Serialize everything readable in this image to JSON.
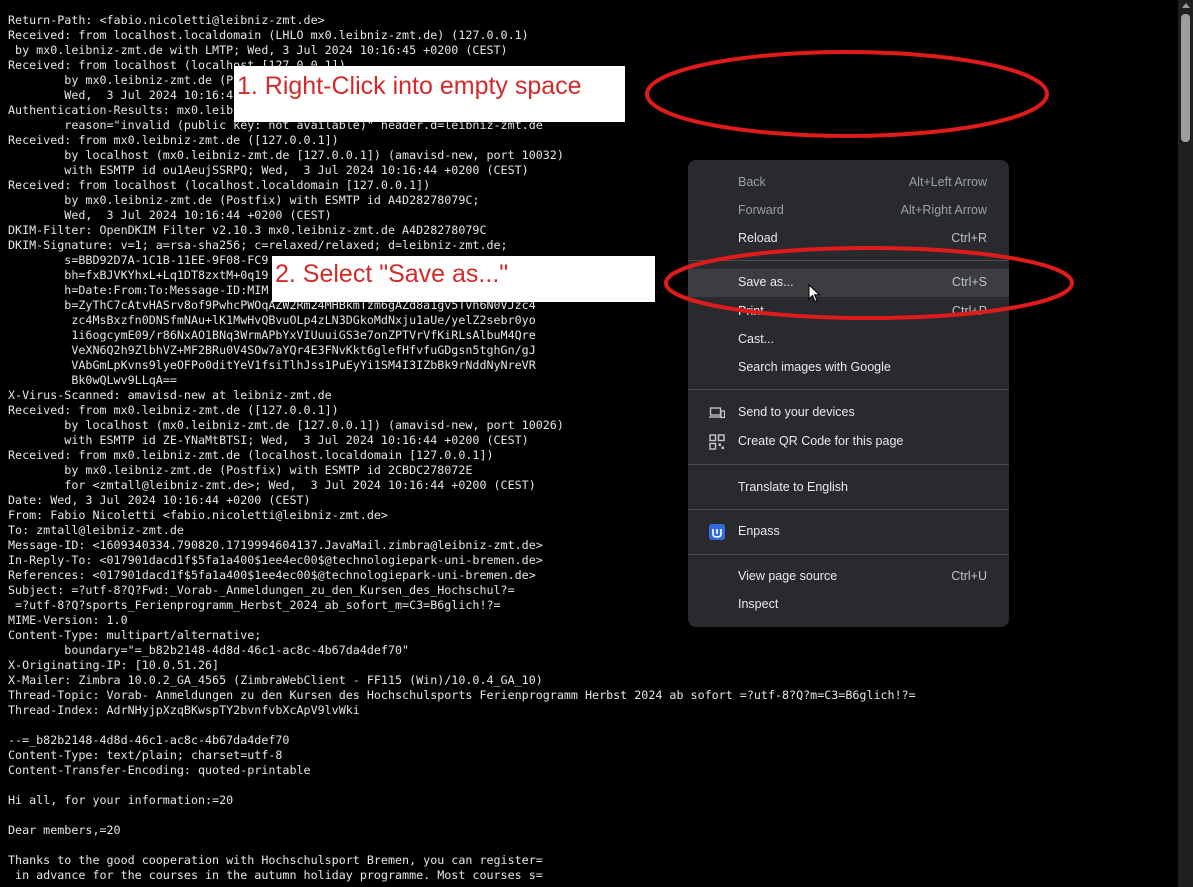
{
  "source_lines": [
    "Return-Path: <fabio.nicoletti@leibniz-zmt.de>",
    "Received: from localhost.localdomain (LHLO mx0.leibniz-zmt.de) (127.0.0.1)",
    " by mx0.leibniz-zmt.de with LMTP; Wed, 3 Jul 2024 10:16:45 +0200 (CEST)",
    "Received: from localhost (localhost [127.0.0.1])",
    "        by mx0.leibniz-zmt.de (P",
    "        Wed,  3 Jul 2024 10:16:4",
    "Authentication-Results: mx0.leibn",
    "        reason=\"invalid (public key: not available)\" header.d=leibniz-zmt.de",
    "Received: from mx0.leibniz-zmt.de ([127.0.0.1])",
    "        by localhost (mx0.leibniz-zmt.de [127.0.0.1]) (amavisd-new, port 10032)",
    "        with ESMTP id ou1AeujSSRPQ; Wed,  3 Jul 2024 10:16:44 +0200 (CEST)",
    "Received: from localhost (localhost.localdomain [127.0.0.1])",
    "        by mx0.leibniz-zmt.de (Postfix) with ESMTP id A4D28278079C;",
    "        Wed,  3 Jul 2024 10:16:44 +0200 (CEST)",
    "DKIM-Filter: OpenDKIM Filter v2.10.3 mx0.leibniz-zmt.de A4D28278079C",
    "DKIM-Signature: v=1; a=rsa-sha256; c=relaxed/relaxed; d=leibniz-zmt.de;",
    "        s=BBD92D7A-1C1B-11EE-9F08-FC9",
    "        bh=fxBJVKYhxL+Lq1DT8zxtM+0q19",
    "        h=Date:From:To:Message-ID:MIM",
    "        b=ZyThC7cAtvHASrv8of9PwhcPWOqAZW2Rm24MHBkmTzm6gAZd8a1gv5Tvh6N0VJzc4",
    "         zc4MsBxzfn0DNSfmNAu+lK1MwHvQBvuOLp4zLN3DGkoMdNxju1aUe/yelZ2sebr0yo",
    "         1i6ogcymE09/r86NxAO1BNq3WrmAPbYxVIUuuiGS3e7onZPTVrVfKiRLsAlbuM4Qre",
    "         VeXN6Q2h9ZlbhVZ+MF2BRu0V4SOw7aYQr4E3FNvKkt6glefHfvfuGDgsn5tghGn/gJ",
    "         VAbGmLpKvns9lyeOFPo0ditYeV1fsiTlhJss1PuEyYi1SM4I3IZbBk9rNddNyNreVR",
    "         Bk0wQLwv9LLqA==",
    "X-Virus-Scanned: amavisd-new at leibniz-zmt.de",
    "Received: from mx0.leibniz-zmt.de ([127.0.0.1])",
    "        by localhost (mx0.leibniz-zmt.de [127.0.0.1]) (amavisd-new, port 10026)",
    "        with ESMTP id ZE-YNaMtBTSI; Wed,  3 Jul 2024 10:16:44 +0200 (CEST)",
    "Received: from mx0.leibniz-zmt.de (localhost.localdomain [127.0.0.1])",
    "        by mx0.leibniz-zmt.de (Postfix) with ESMTP id 2CBDC278072E",
    "        for <zmtall@leibniz-zmt.de>; Wed,  3 Jul 2024 10:16:44 +0200 (CEST)",
    "Date: Wed, 3 Jul 2024 10:16:44 +0200 (CEST)",
    "From: Fabio Nicoletti <fabio.nicoletti@leibniz-zmt.de>",
    "To: zmtall@leibniz-zmt.de",
    "Message-ID: <1609340334.790820.1719994604137.JavaMail.zimbra@leibniz-zmt.de>",
    "In-Reply-To: <017901dacd1f$5fa1a400$1ee4ec00$@technologiepark-uni-bremen.de>",
    "References: <017901dacd1f$5fa1a400$1ee4ec00$@technologiepark-uni-bremen.de>",
    "Subject: =?utf-8?Q?Fwd:_Vorab-_Anmeldungen_zu_den_Kursen_des_Hochschul?=",
    " =?utf-8?Q?sports_Ferienprogramm_Herbst_2024_ab_sofort_m=C3=B6glich!?=",
    "MIME-Version: 1.0",
    "Content-Type: multipart/alternative;",
    "        boundary=\"=_b82b2148-4d8d-46c1-ac8c-4b67da4def70\"",
    "X-Originating-IP: [10.0.51.26]",
    "X-Mailer: Zimbra 10.0.2_GA_4565 (ZimbraWebClient - FF115 (Win)/10.0.4_GA_10)",
    "Thread-Topic: Vorab- Anmeldungen zu den Kursen des Hochschulsports Ferienprogramm Herbst 2024 ab sofort =?utf-8?Q?m=C3=B6glich!?=",
    "Thread-Index: AdrNHyjpXzqBKwspTY2bvnfvbXcApV9lvWki",
    "",
    "--=_b82b2148-4d8d-46c1-ac8c-4b67da4def70",
    "Content-Type: text/plain; charset=utf-8",
    "Content-Transfer-Encoding: quoted-printable",
    "",
    "Hi all, for your information:=20",
    "",
    "Dear members,=20",
    "",
    "Thanks to the good cooperation with Hochschulsport Bremen, you can register=",
    " in advance for the courses in the autumn holiday programme. Most courses s="
  ],
  "annotations": {
    "step1": "1. Right-Click into empty space",
    "step2": "2. Select \"Save as...\"",
    "color": "#e01b1b"
  },
  "context_menu": {
    "back": {
      "label": "Back",
      "shortcut": "Alt+Left Arrow"
    },
    "forward": {
      "label": "Forward",
      "shortcut": "Alt+Right Arrow"
    },
    "reload": {
      "label": "Reload",
      "shortcut": "Ctrl+R"
    },
    "save_as": {
      "label": "Save as...",
      "shortcut": "Ctrl+S"
    },
    "print": {
      "label": "Print...",
      "shortcut": "Ctrl+P"
    },
    "cast": {
      "label": "Cast..."
    },
    "search_images": {
      "label": "Search images with Google"
    },
    "send_devices": {
      "label": "Send to your devices",
      "icon": "devices-icon"
    },
    "qr_code": {
      "label": "Create QR Code for this page",
      "icon": "qr-code-icon"
    },
    "translate": {
      "label": "Translate to English"
    },
    "enpass": {
      "label": "Enpass",
      "icon": "enpass-icon"
    },
    "view_source": {
      "label": "View page source",
      "shortcut": "Ctrl+U"
    },
    "inspect": {
      "label": "Inspect"
    }
  }
}
